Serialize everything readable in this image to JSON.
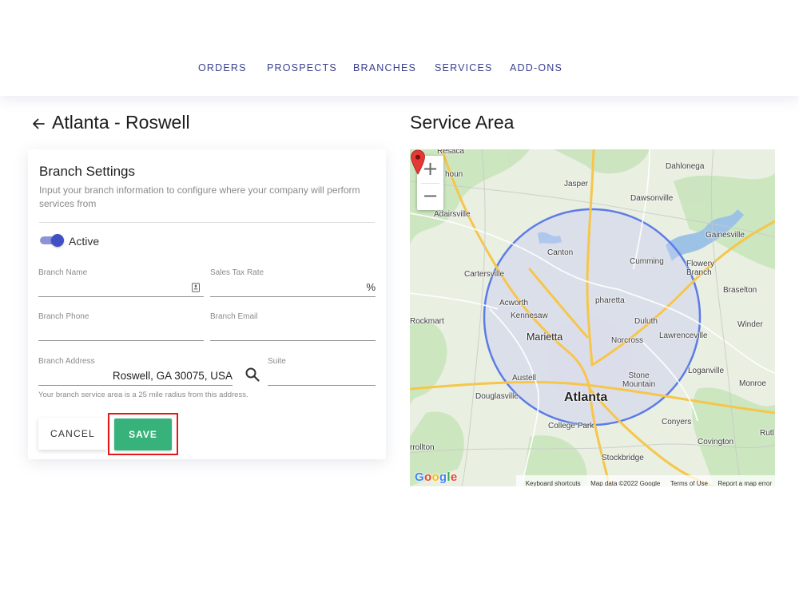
{
  "nav": {
    "items": [
      "ORDERS",
      "PROSPECTS",
      "BRANCHES",
      "SERVICES",
      "ADD-ONS"
    ]
  },
  "branch": {
    "title": "Atlanta - Roswell"
  },
  "settings": {
    "title": "Branch Settings",
    "description": "Input your branch information to configure where your company will perform services from",
    "active_label": "Active",
    "active": true,
    "fields": {
      "branch_name_label": "Branch Name",
      "branch_name_value": "",
      "sales_tax_label": "Sales Tax Rate",
      "sales_tax_value": "",
      "sales_tax_suffix": "%",
      "branch_phone_label": "Branch Phone",
      "branch_phone_value": "",
      "branch_email_label": "Branch Email",
      "branch_email_value": "",
      "address_label": "Branch Address",
      "address_value": "Roswell, GA 30075, USA",
      "suite_label": "Suite",
      "suite_value": ""
    },
    "helper_text": "Your branch service area is a 25 mile radius from this address.",
    "cancel_label": "CANCEL",
    "save_label": "SAVE"
  },
  "map": {
    "title": "Service Area",
    "zoom_in": "+",
    "zoom_out": "−",
    "labels": {
      "resaca": "Resaca",
      "calhoun": "houn",
      "jasper": "Jasper",
      "dahlonega": "Dahlonega",
      "dawsonville": "Dawsonville",
      "adairsville": "Adairsville",
      "gainesville": "Gainesville",
      "canton": "Canton",
      "cumming": "Cumming",
      "flowery_branch": "Flowery\nBranch",
      "cartersville": "Cartersville",
      "braselton": "Braselton",
      "acworth": "Acworth",
      "alpharetta": "pharetta",
      "kennesaw": "Kennesaw",
      "rockmart": "Rockmart",
      "duluth": "Duluth",
      "winder": "Winder",
      "marietta": "Marietta",
      "lawrenceville": "Lawrenceville",
      "norcross": "Norcross",
      "loganville": "Loganville",
      "austell": "Austell",
      "stone_mountain": "Stone\nMountain",
      "monroe": "Monroe",
      "douglasville": "Douglasville",
      "atlanta": "Atlanta",
      "conyers": "Conyers",
      "college_park": "College Park",
      "covington": "Covington",
      "carrollton": "rrollton",
      "stockbridge": "Stockbridge",
      "rutledge": "Rutl"
    },
    "footer": {
      "shortcuts": "Keyboard shortcuts",
      "data": "Map data ©2022 Google",
      "terms": "Terms of Use",
      "report": "Report a map error"
    },
    "logo": "Google",
    "circle_color": "#5b7be8",
    "marker_color": "#e53935"
  }
}
